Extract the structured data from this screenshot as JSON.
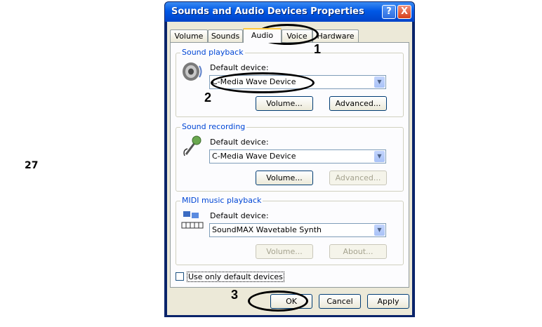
{
  "page_number": "27",
  "window": {
    "title": "Sounds and Audio Devices Properties",
    "help_label": "?",
    "close_label": "X"
  },
  "tabs": [
    "Volume",
    "Sounds",
    "Audio",
    "Voice",
    "Hardware"
  ],
  "active_tab": "Audio",
  "sound_playback": {
    "title": "Sound playback",
    "device_label": "Default device:",
    "selected": "C-Media Wave Device",
    "volume_label": "Volume...",
    "advanced_label": "Advanced..."
  },
  "sound_recording": {
    "title": "Sound recording",
    "device_label": "Default device:",
    "selected": "C-Media Wave Device",
    "volume_label": "Volume...",
    "advanced_label": "Advanced..."
  },
  "midi_playback": {
    "title": "MIDI music playback",
    "device_label": "Default device:",
    "selected": "SoundMAX Wavetable Synth",
    "volume_label": "Volume...",
    "about_label": "About..."
  },
  "use_default_label": "Use only default devices",
  "buttons": {
    "ok": "OK",
    "cancel": "Cancel",
    "apply": "Apply"
  },
  "callouts": [
    "1",
    "2",
    "3"
  ]
}
